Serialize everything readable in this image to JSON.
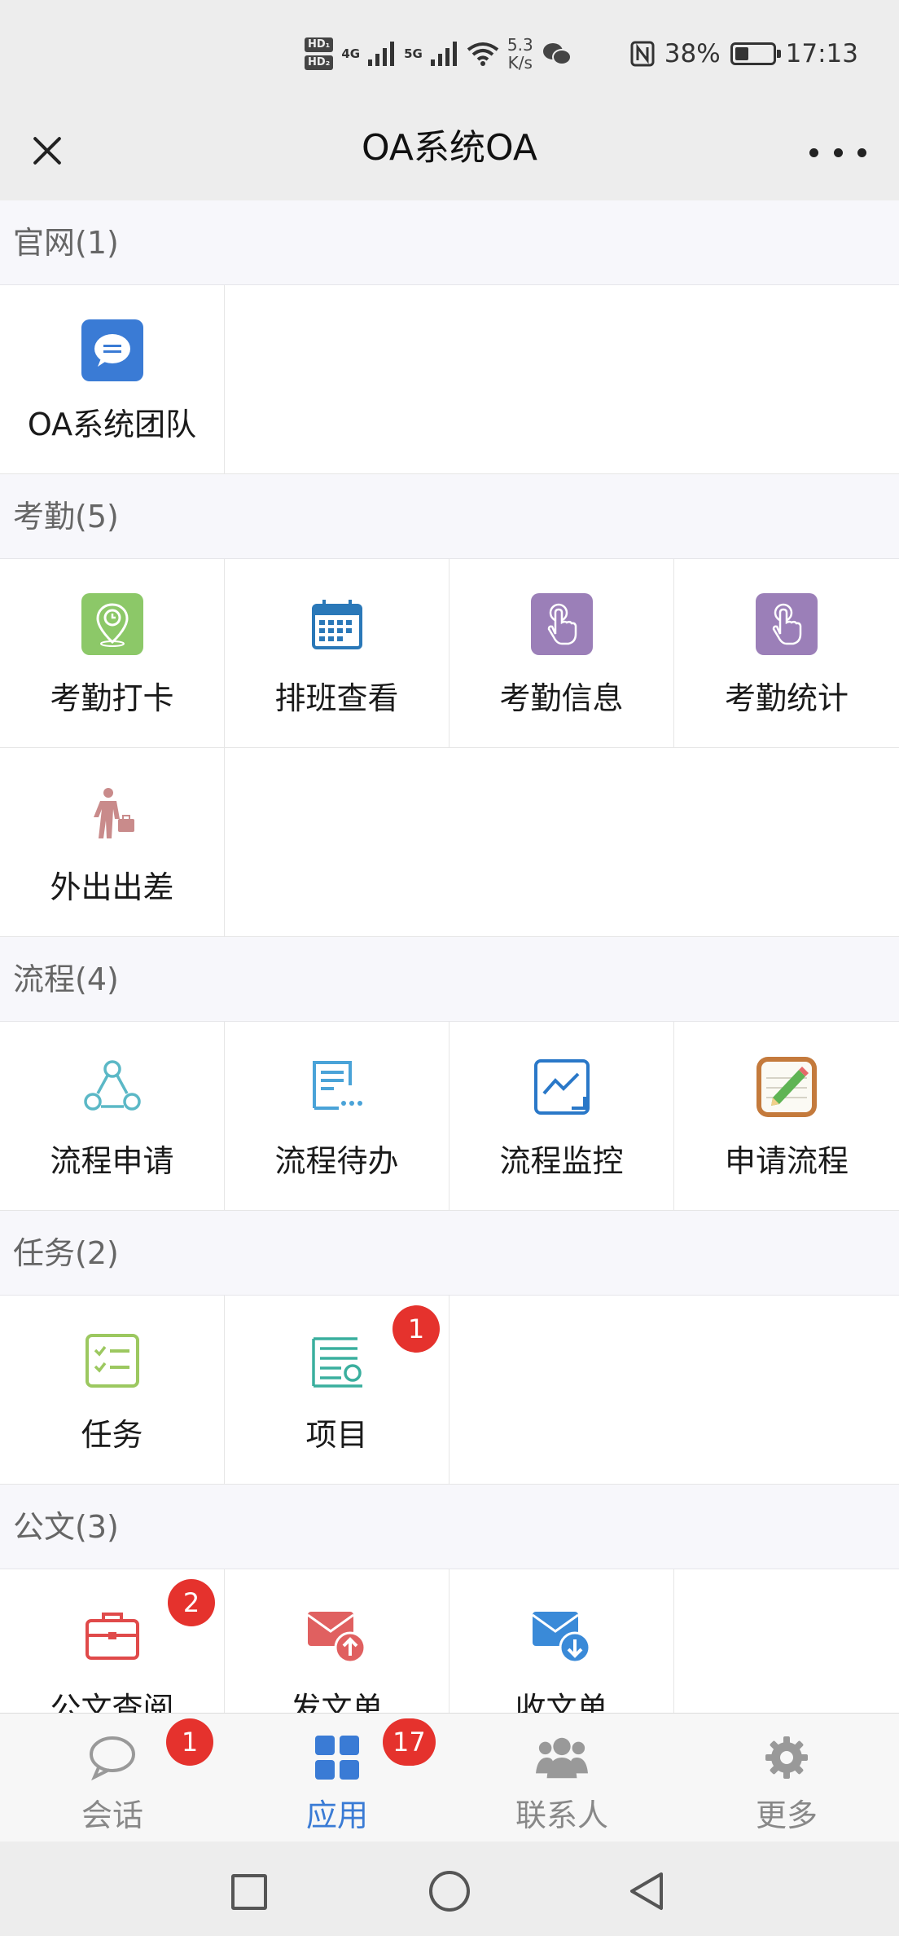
{
  "status_bar": {
    "hd1": "HD₁",
    "hd2": "HD₂",
    "net1": "4G",
    "net2": "5G",
    "speed_value": "5.3",
    "speed_unit": "K/s",
    "battery": "38%",
    "time": "17:13"
  },
  "titlebar": {
    "title": "OA系统OA"
  },
  "sections": [
    {
      "header": "官网(1)",
      "items": [
        {
          "label": "OA系统团队",
          "icon": "chat-bubble-icon"
        }
      ]
    },
    {
      "header": "考勤(5)",
      "items": [
        {
          "label": "考勤打卡",
          "icon": "location-clock-icon"
        },
        {
          "label": "排班查看",
          "icon": "calendar-icon"
        },
        {
          "label": "考勤信息",
          "icon": "touch-hand-icon"
        },
        {
          "label": "考勤统计",
          "icon": "touch-hand-icon"
        },
        {
          "label": "外出出差",
          "icon": "business-traveler-icon"
        }
      ]
    },
    {
      "header": "流程(4)",
      "items": [
        {
          "label": "流程申请",
          "icon": "flow-nodes-icon"
        },
        {
          "label": "流程待办",
          "icon": "todo-list-icon"
        },
        {
          "label": "流程监控",
          "icon": "monitor-chart-icon"
        },
        {
          "label": "申请流程",
          "icon": "notepad-pencil-icon"
        }
      ]
    },
    {
      "header": "任务(2)",
      "items": [
        {
          "label": "任务",
          "icon": "checklist-icon"
        },
        {
          "label": "项目",
          "icon": "project-list-icon",
          "badge": "1"
        }
      ]
    },
    {
      "header": "公文(3)",
      "items": [
        {
          "label": "公文查阅",
          "icon": "briefcase-icon",
          "badge": "2"
        },
        {
          "label": "发文单",
          "icon": "mail-send-icon"
        },
        {
          "label": "收文单",
          "icon": "mail-receive-icon"
        }
      ]
    }
  ],
  "tabbar": [
    {
      "label": "会话",
      "icon": "chat-icon",
      "badge": "1"
    },
    {
      "label": "应用",
      "icon": "apps-grid-icon",
      "badge": "17",
      "active": true
    },
    {
      "label": "联系人",
      "icon": "contacts-icon"
    },
    {
      "label": "更多",
      "icon": "gear-icon"
    }
  ],
  "colors": {
    "accent": "#3a7bd5",
    "badge": "#e5322d"
  }
}
